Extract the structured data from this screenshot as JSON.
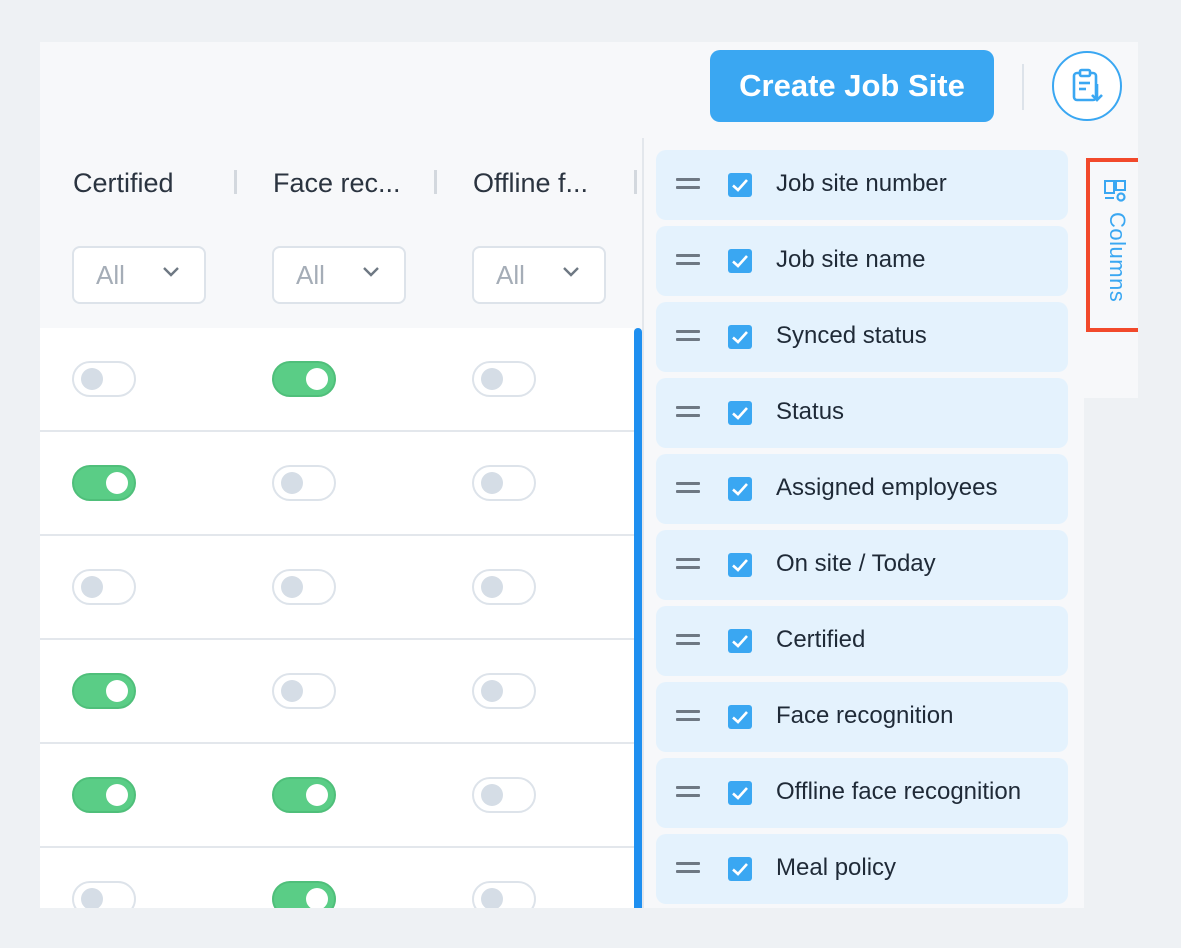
{
  "header": {
    "create_button": "Create Job Site",
    "export_icon": "clipboard-export-icon"
  },
  "table": {
    "columns": [
      {
        "label": "Certified",
        "filter": "All"
      },
      {
        "label": "Face rec...",
        "filter": "All"
      },
      {
        "label": "Offline f...",
        "filter": "All"
      }
    ],
    "rows": [
      {
        "certified": false,
        "face_recognition": true,
        "offline_face_recognition": false
      },
      {
        "certified": true,
        "face_recognition": false,
        "offline_face_recognition": false
      },
      {
        "certified": false,
        "face_recognition": false,
        "offline_face_recognition": false
      },
      {
        "certified": true,
        "face_recognition": false,
        "offline_face_recognition": false
      },
      {
        "certified": true,
        "face_recognition": true,
        "offline_face_recognition": false
      },
      {
        "certified": false,
        "face_recognition": true,
        "offline_face_recognition": false
      }
    ]
  },
  "columns_panel": {
    "tab_label": "Columns",
    "items": [
      {
        "label": "Job site number",
        "checked": true
      },
      {
        "label": "Job site name",
        "checked": true
      },
      {
        "label": "Synced status",
        "checked": true
      },
      {
        "label": "Status",
        "checked": true
      },
      {
        "label": "Assigned employees",
        "checked": true
      },
      {
        "label": "On site / Today",
        "checked": true
      },
      {
        "label": "Certified",
        "checked": true
      },
      {
        "label": "Face recognition",
        "checked": true
      },
      {
        "label": "Offline face recognition",
        "checked": true
      },
      {
        "label": "Meal policy",
        "checked": true
      }
    ]
  },
  "colors": {
    "accent": "#3aa7f2",
    "toggle_on": "#5acd86",
    "highlight": "#f2492b",
    "panel_item_bg": "#e4f2fd"
  }
}
